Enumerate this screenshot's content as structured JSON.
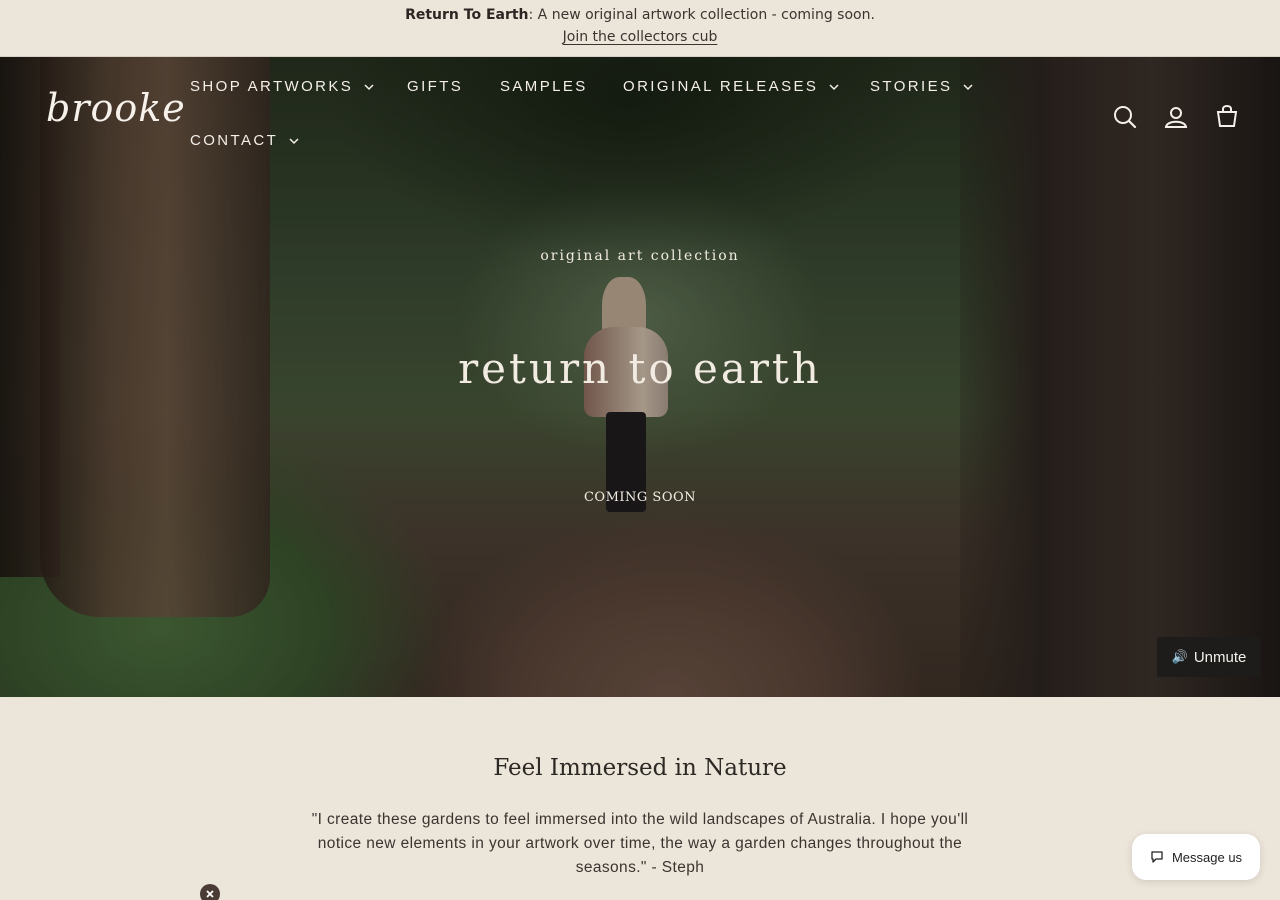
{
  "announcement": {
    "bold": "Return To Earth",
    "text": ": A new original artwork collection - coming soon.",
    "link": "Join the collectors cub"
  },
  "header": {
    "logo": "brooke",
    "nav": [
      {
        "label": "SHOP ARTWORKS",
        "has_dropdown": true
      },
      {
        "label": "GIFTS",
        "has_dropdown": false
      },
      {
        "label": "SAMPLES",
        "has_dropdown": false
      },
      {
        "label": "ORIGINAL RELEASES",
        "has_dropdown": true
      },
      {
        "label": "STORIES",
        "has_dropdown": true
      },
      {
        "label": "CONTACT",
        "has_dropdown": true
      }
    ],
    "icons": [
      "search-icon",
      "account-icon",
      "cart-icon"
    ]
  },
  "hero": {
    "subtitle": "original art collection",
    "title": "return to earth",
    "cta": "COMING SOON",
    "unmute": "Unmute"
  },
  "content": {
    "title": "Feel Immersed in Nature",
    "quote": "\"I create these gardens to feel immersed into the wild landscapes of Australia. I hope you'll notice new elements in your artwork over time, the way a garden changes throughout the seasons.\" - Steph"
  },
  "chat": {
    "label": "Message us"
  },
  "colors": {
    "background": "#ece5da",
    "text": "#2f2b27",
    "hero_text": "#f1ebe2",
    "unmute_bg": "#1d1c1b"
  }
}
